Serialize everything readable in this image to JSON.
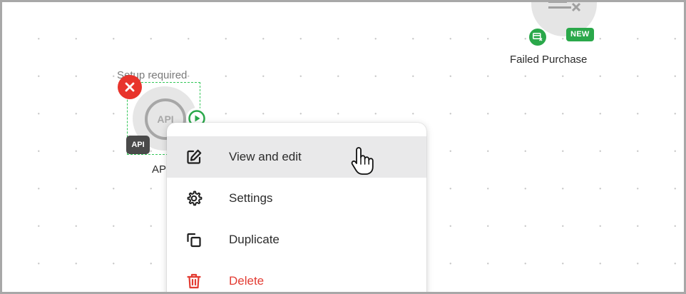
{
  "canvas": {
    "failed_purchase_node": {
      "label": "Failed Purchase",
      "badge": "NEW",
      "icon": "payment-failed-icon"
    },
    "api_node": {
      "status_text": "Setup required",
      "circle_text": "API",
      "tag_text": "API",
      "label": "AP"
    }
  },
  "context_menu": {
    "items": [
      {
        "label": "View and edit",
        "icon": "edit-icon"
      },
      {
        "label": "Settings",
        "icon": "gear-icon"
      },
      {
        "label": "Duplicate",
        "icon": "duplicate-icon"
      },
      {
        "label": "Delete",
        "icon": "trash-icon"
      }
    ]
  },
  "colors": {
    "success": "#2aa84a",
    "danger": "#e8342c",
    "selection": "#34c759"
  }
}
